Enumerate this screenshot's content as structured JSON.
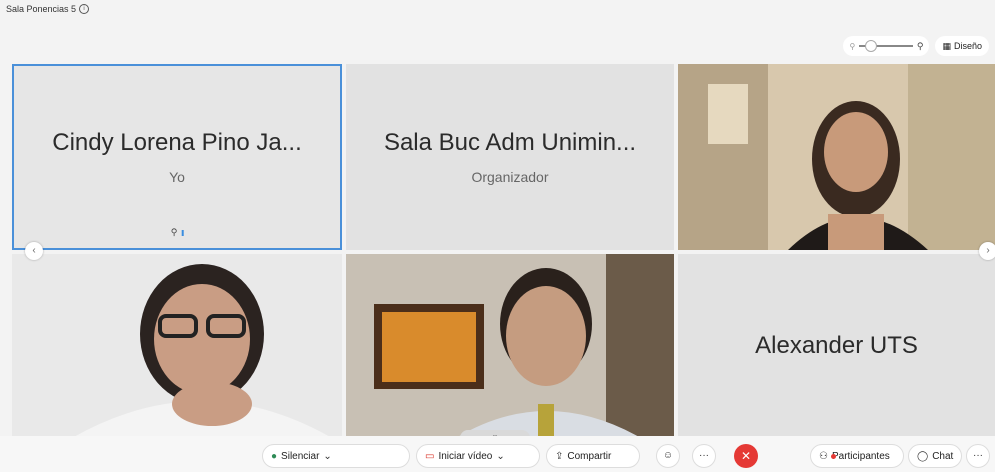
{
  "meeting": {
    "title": "Sala Ponencias 5"
  },
  "view": {
    "layout_label": "Diseño",
    "zoom_level": 0.1
  },
  "tiles": [
    {
      "name": "Cindy Lorena Pino Ja...",
      "role": "Yo"
    },
    {
      "name": "Sala Buc Adm Unimin...",
      "role": "Organizador"
    },
    {
      "name": "Alexander UTS"
    }
  ],
  "toolbar": {
    "mute_label": "Silenciar",
    "video_label": "Iniciar vídeo",
    "share_label": "Compartir",
    "participants_label": "Participantes",
    "chat_label": "Chat",
    "more_label": "···"
  },
  "colors": {
    "accent": "#4a90d9",
    "end_call": "#e53935",
    "mic": "#2e8b57",
    "video_off": "#d93025"
  }
}
